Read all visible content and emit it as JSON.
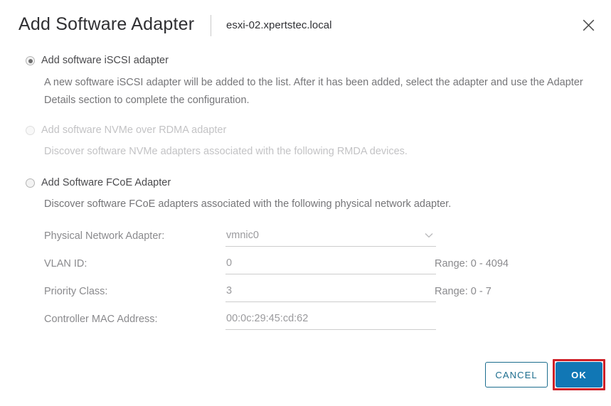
{
  "dialog": {
    "title": "Add Software Adapter",
    "subtitle": "esxi-02.xpertstec.local",
    "close_icon": "close-icon"
  },
  "options": [
    {
      "label": "Add software iSCSI adapter",
      "selected": true,
      "disabled": false,
      "description": "A new software iSCSI adapter will be added to the list. After it has been added, select the adapter and use the Adapter Details section to complete the configuration."
    },
    {
      "label": "Add software NVMe over RDMA adapter",
      "selected": false,
      "disabled": true,
      "description": "Discover software NVMe adapters associated with the following RMDA devices."
    },
    {
      "label": "Add Software FCoE Adapter",
      "selected": false,
      "disabled": false,
      "description": "Discover software FCoE adapters associated with the following physical network adapter."
    }
  ],
  "form": {
    "physical_network_adapter": {
      "label": "Physical Network Adapter:",
      "value": "vmnic0",
      "icon": "chevron-down-icon"
    },
    "vlan_id": {
      "label": "VLAN ID:",
      "value": "0",
      "range": "Range: 0 - 4094"
    },
    "priority_class": {
      "label": "Priority Class:",
      "value": "3",
      "range": "Range: 0 - 7"
    },
    "controller_mac_address": {
      "label": "Controller MAC Address:",
      "value": "00:0c:29:45:cd:62"
    }
  },
  "footer": {
    "cancel_label": "CANCEL",
    "ok_label": "OK"
  },
  "colors": {
    "primary_button": "#1177b5",
    "secondary_button_border": "#1c6d8e",
    "annotation": "#cf2027",
    "title_text": "#2f2f32",
    "body_text": "#757578",
    "disabled_text": "#c3c3c5"
  }
}
